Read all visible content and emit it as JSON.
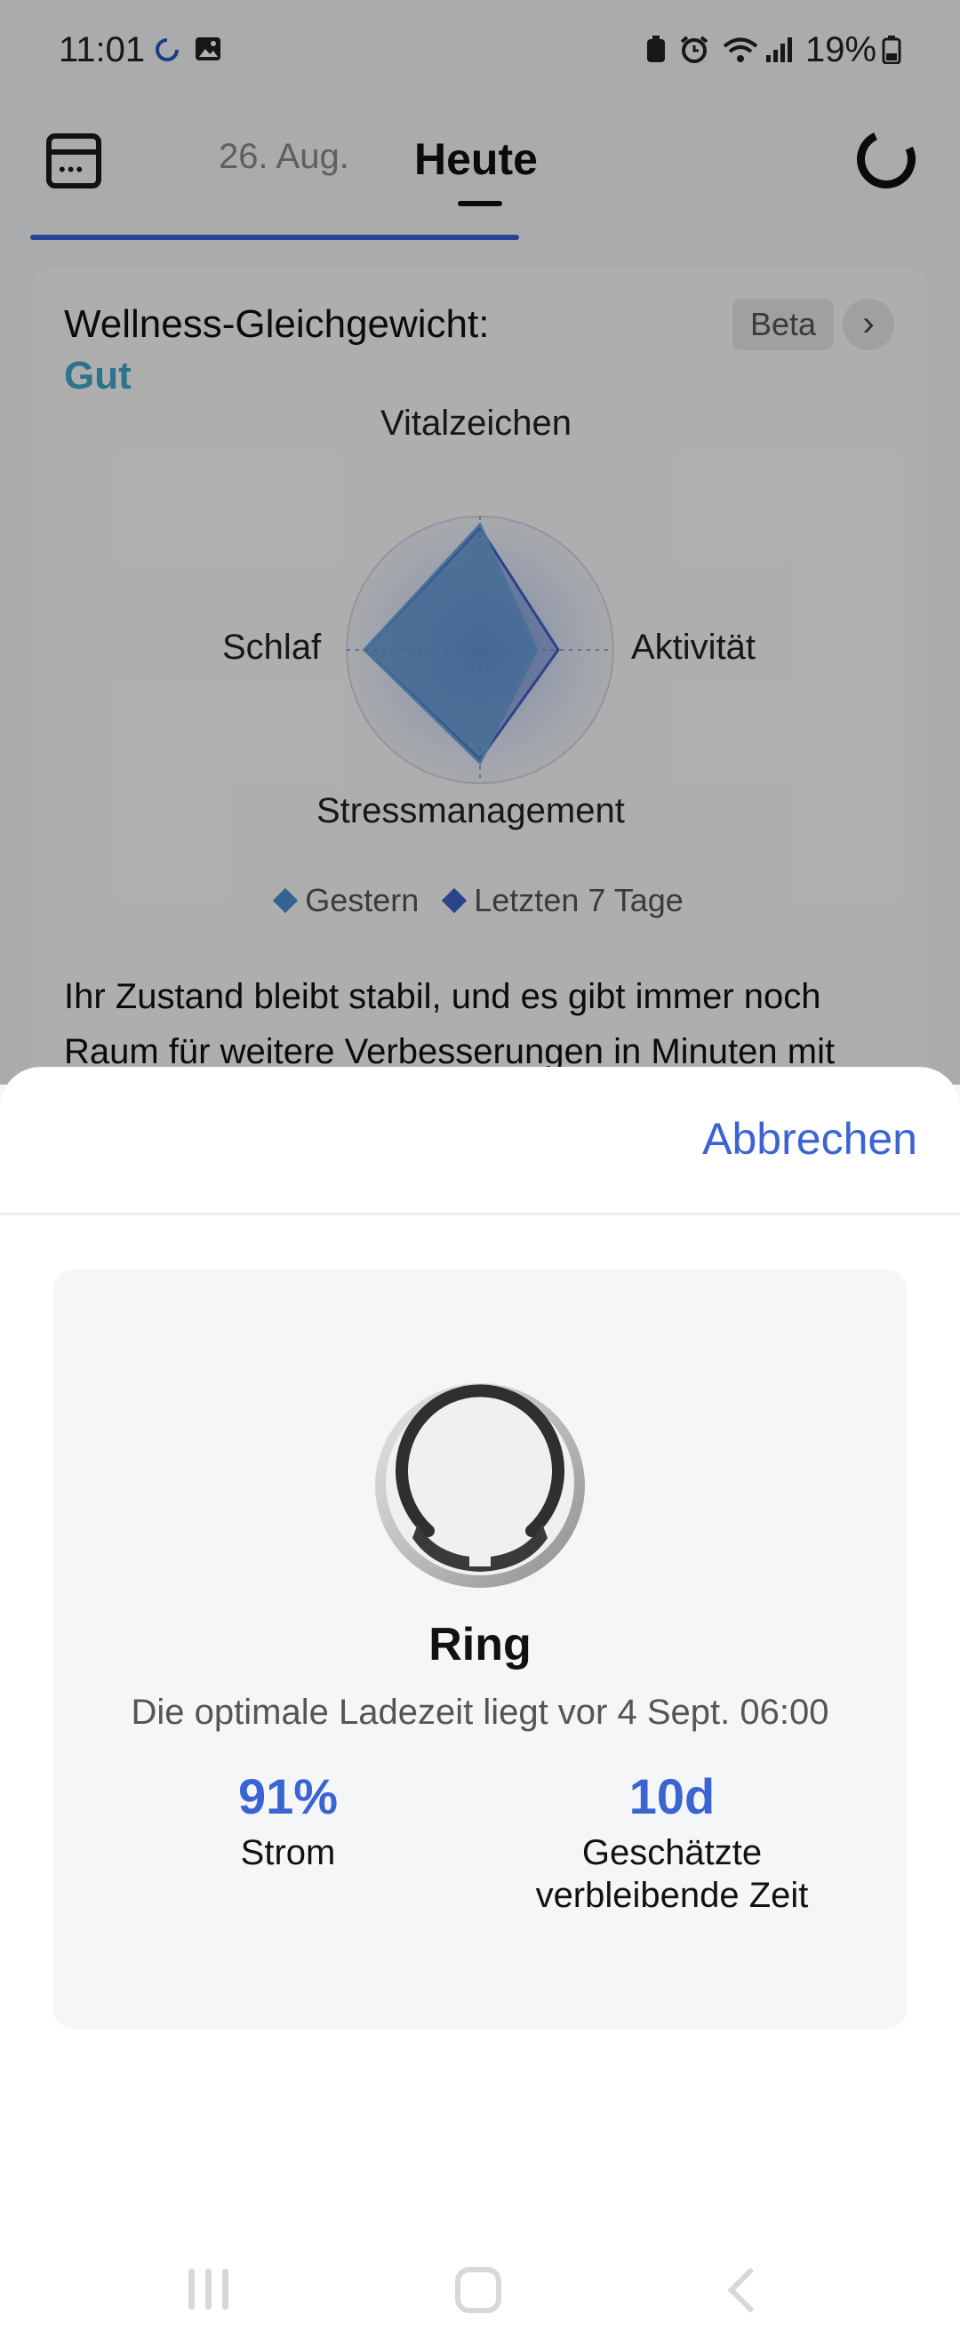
{
  "status_bar": {
    "time": "11:01",
    "battery": "19%"
  },
  "top_nav": {
    "prev_tab": "26. Aug.",
    "current_tab": "Heute"
  },
  "wellness": {
    "title": "Wellness-Gleichgewicht:",
    "status": "Gut",
    "badge": "Beta",
    "radar_labels": {
      "top": "Vitalzeichen",
      "right": "Aktivität",
      "bottom": "Stressmanagement",
      "left": "Schlaf"
    },
    "legend": [
      {
        "label": "Gestern",
        "color": "#4a8fd0"
      },
      {
        "label": "Letzten 7 Tage",
        "color": "#3f5fc4"
      }
    ],
    "description": "Ihr Zustand bleibt stabil, und es gibt immer noch Raum für weitere Verbesserungen in Minuten mit"
  },
  "sheet": {
    "cancel_label": "Abbrechen",
    "device_name": "Ring",
    "charge_hint": "Die optimale Ladezeit liegt vor 4 Sept. 06:00",
    "stats": {
      "power_value": "91%",
      "power_label": "Strom",
      "time_value": "10d",
      "time_label_line1": "Geschätzte",
      "time_label_line2": "verbleibende Zeit"
    }
  },
  "colors": {
    "accent": "#3a64d2",
    "status_good": "#41a6c8"
  },
  "icons": {
    "status_bar": [
      "sync-icon",
      "image-icon",
      "battery-saver-icon",
      "alarm-icon",
      "wifi-icon",
      "signal-icon",
      "battery-icon"
    ],
    "nav": [
      "calendar-icon",
      "refresh-icon"
    ],
    "system_nav": [
      "recents-icon",
      "home-icon",
      "back-icon"
    ]
  }
}
